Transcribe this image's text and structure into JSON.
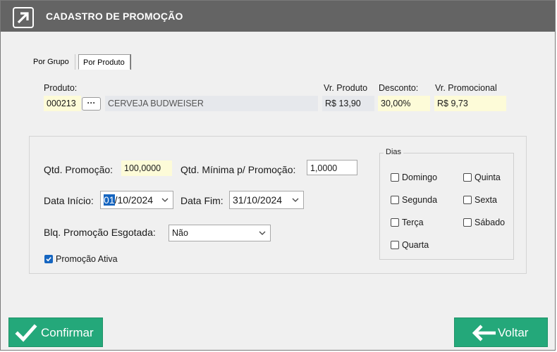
{
  "window": {
    "title": "CADASTRO DE PROMOÇÃO",
    "titlebar_color": "#646464"
  },
  "tabs": [
    {
      "label": "Por Grupo",
      "active": false
    },
    {
      "label": "Por Produto",
      "active": true
    }
  ],
  "product": {
    "label": "Produto:",
    "code": "000213",
    "search_button": "···",
    "description": "CERVEJA BUDWEISER",
    "price_label": "Vr. Produto",
    "price_value": "R$ 13,90",
    "discount_label": "Desconto:",
    "discount_value": "30,00%",
    "promo_label": "Vr. Promocional",
    "promo_value": "R$ 9,73"
  },
  "form": {
    "qty_label": "Qtd. Promoção:",
    "qty_value": "100,0000",
    "min_qty_label": "Qtd. Mínima p/ Promoção:",
    "min_qty_value": "1,0000",
    "start_label": "Data Início:",
    "start_value_selected": "01",
    "start_value_rest": "/10/2024",
    "end_label": "Data Fim:",
    "end_value": "31/10/2024",
    "block_label": "Blq. Promoção Esgotada:",
    "block_value": "Não",
    "active_label": "Promoção Ativa",
    "active_checked": true
  },
  "days": {
    "title": "Dias",
    "items": [
      {
        "label": "Domingo",
        "checked": false
      },
      {
        "label": "Segunda",
        "checked": false
      },
      {
        "label": "Terça",
        "checked": false
      },
      {
        "label": "Quarta",
        "checked": false
      },
      {
        "label": "Quinta",
        "checked": false
      },
      {
        "label": "Sexta",
        "checked": false
      },
      {
        "label": "Sábado",
        "checked": false
      }
    ]
  },
  "actions": {
    "confirm_label": "Confirmar",
    "back_label": "Voltar",
    "button_color": "#24a87a"
  },
  "icons": {
    "app": "arrow-up-right-icon",
    "confirm": "check-icon",
    "back": "arrow-left-icon",
    "dropdown": "chevron-down-icon"
  }
}
